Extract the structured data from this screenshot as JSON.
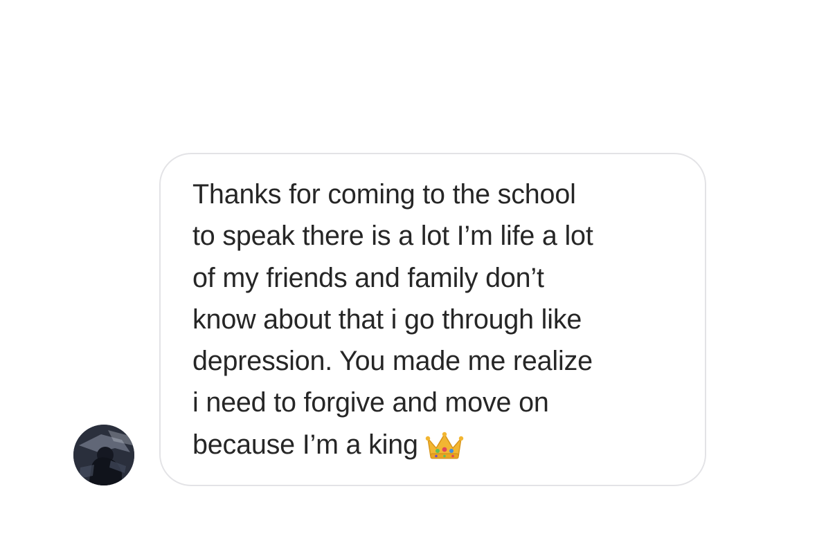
{
  "conversation": {
    "message": {
      "lines": [
        "Thanks for coming to the school",
        "to speak there is a lot I’m life a lot",
        "of my friends and family don’t",
        "know about that i go through like",
        "depression. You made me realize",
        "i need to forgive and move on",
        "because I’m a king"
      ],
      "trailing_emoji": "crown-emoji"
    },
    "sender_avatar": {
      "icon": "profile-photo"
    }
  },
  "colors": {
    "background": "#ffffff",
    "bubble_border": "#e3e3e6",
    "text": "#262626",
    "crown_gold": "#f2b632"
  }
}
